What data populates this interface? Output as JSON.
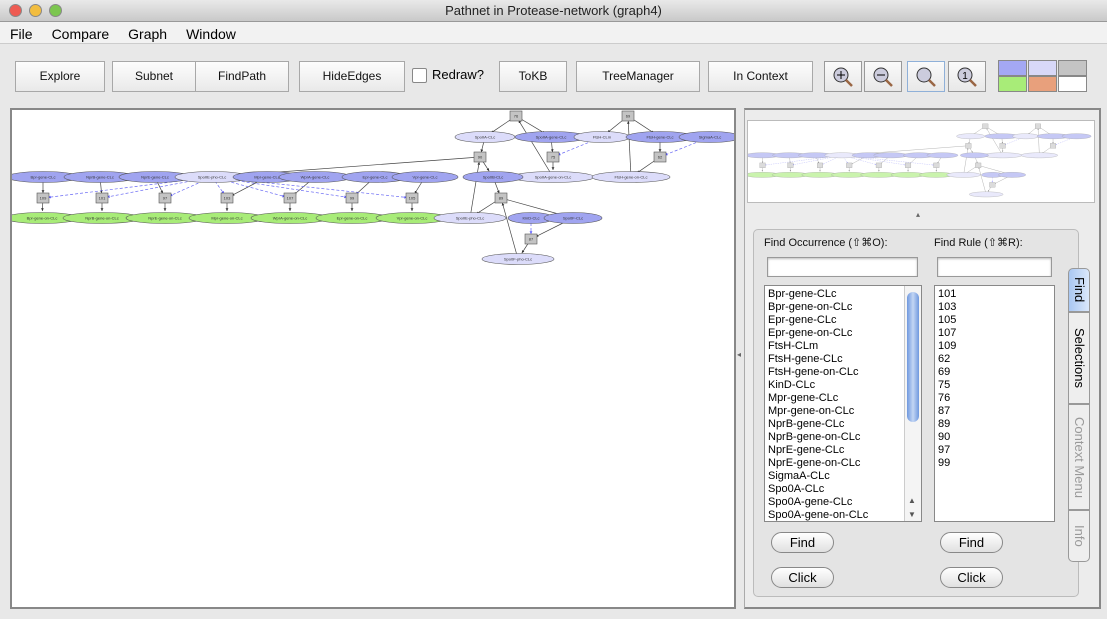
{
  "window": {
    "title": "Pathnet in Protease-network (graph4)"
  },
  "menu": [
    "File",
    "Compare",
    "Graph",
    "Window"
  ],
  "toolbar": {
    "explore": "Explore",
    "subnet": "Subnet",
    "findpath": "FindPath",
    "hideedges": "HideEdges",
    "redraw": "Redraw?",
    "redraw_checked": false,
    "tokb": "ToKB",
    "treemanager": "TreeManager",
    "incontext": "In Context"
  },
  "zoom_buttons": [
    "zoom-in-icon",
    "zoom-out-icon",
    "zoom-fit-icon",
    "zoom-actual-icon"
  ],
  "legend_colors": [
    "#a4a8f4",
    "#d8d8f8",
    "#c4c4c4",
    "#a8ec78",
    "#e8a07c",
    "#ffffff"
  ],
  "graph": {
    "colors": {
      "protein": "#a0a4f0",
      "complex": "#dcdcfa",
      "gene_on": "#a8ec78",
      "rule": "#c4c4c4"
    },
    "nodes": [
      {
        "id": "n1",
        "label": "Bpr-gene-CLc",
        "kind": "protein"
      },
      {
        "id": "n2",
        "label": "NprB-gene-CLc",
        "kind": "protein"
      },
      {
        "id": "n3",
        "label": "NprE-gene-CLc",
        "kind": "protein"
      },
      {
        "id": "n4",
        "label": "SpoIIE-pho-CLc",
        "kind": "complex"
      },
      {
        "id": "n5",
        "label": "Mpr-gene-CLc",
        "kind": "protein"
      },
      {
        "id": "n6",
        "label": "WprA-gene-CLc",
        "kind": "protein"
      },
      {
        "id": "n7",
        "label": "Epr-gene-CLc",
        "kind": "protein"
      },
      {
        "id": "n8",
        "label": "Vpr-gene-CLc",
        "kind": "protein"
      },
      {
        "id": "r1",
        "label": "109",
        "kind": "rule"
      },
      {
        "id": "r2",
        "label": "101",
        "kind": "rule"
      },
      {
        "id": "r3",
        "label": "97",
        "kind": "rule"
      },
      {
        "id": "r4",
        "label": "103",
        "kind": "rule"
      },
      {
        "id": "r5",
        "label": "107",
        "kind": "rule"
      },
      {
        "id": "r6",
        "label": "99",
        "kind": "rule"
      },
      {
        "id": "r7",
        "label": "105",
        "kind": "rule"
      },
      {
        "id": "g1",
        "label": "Bpr-gene-on-CLc",
        "kind": "gene_on"
      },
      {
        "id": "g2",
        "label": "NprB-gene-on-CLc",
        "kind": "gene_on"
      },
      {
        "id": "g3",
        "label": "NprE-gene-on-CLc",
        "kind": "gene_on"
      },
      {
        "id": "g4",
        "label": "Mpr-gene-on-CLc",
        "kind": "gene_on"
      },
      {
        "id": "g5",
        "label": "WprA-gene-on-CLc",
        "kind": "gene_on"
      },
      {
        "id": "g6",
        "label": "Epr-gene-on-CLc",
        "kind": "gene_on"
      },
      {
        "id": "g7",
        "label": "Vpr-gene-on-CLc",
        "kind": "gene_on"
      },
      {
        "id": "r76",
        "label": "76",
        "kind": "rule"
      },
      {
        "id": "r69",
        "label": "69",
        "kind": "rule"
      },
      {
        "id": "s1",
        "label": "SpoIIA-CLc",
        "kind": "complex"
      },
      {
        "id": "s2",
        "label": "SpoIIA-gene-CLc",
        "kind": "protein"
      },
      {
        "id": "f1",
        "label": "FtsH-CLm",
        "kind": "complex"
      },
      {
        "id": "f2",
        "label": "FtsH-gene-CLc",
        "kind": "protein"
      },
      {
        "id": "sa",
        "label": "SigmaA-CLc",
        "kind": "protein"
      },
      {
        "id": "r90",
        "label": "90",
        "kind": "rule"
      },
      {
        "id": "r75",
        "label": "75",
        "kind": "rule"
      },
      {
        "id": "r62",
        "label": "62",
        "kind": "rule"
      },
      {
        "id": "s3",
        "label": "SpoIIA-gene-on-CLc",
        "kind": "complex"
      },
      {
        "id": "f3",
        "label": "FtsH-gene-on-CLc",
        "kind": "complex"
      },
      {
        "id": "b0",
        "label": "Spo0B-CLc",
        "kind": "protein"
      },
      {
        "id": "r89",
        "label": "89",
        "kind": "rule"
      },
      {
        "id": "e1",
        "label": "SpoIIE-pho-CLc",
        "kind": "complex"
      },
      {
        "id": "k1",
        "label": "KinD-CLc",
        "kind": "protein"
      },
      {
        "id": "sf",
        "label": "Spo0F-CLc",
        "kind": "protein"
      },
      {
        "id": "r87",
        "label": "87",
        "kind": "rule"
      },
      {
        "id": "fp",
        "label": "Spo0F-pho-CLc",
        "kind": "complex"
      }
    ],
    "edges": [
      [
        "n1",
        "r1",
        "solid"
      ],
      [
        "n2",
        "r2",
        "solid"
      ],
      [
        "n3",
        "r3",
        "solid"
      ],
      [
        "n5",
        "r4",
        "solid"
      ],
      [
        "n6",
        "r5",
        "solid"
      ],
      [
        "n7",
        "r6",
        "solid"
      ],
      [
        "n8",
        "r7",
        "solid"
      ],
      [
        "r1",
        "g1",
        "solid"
      ],
      [
        "r2",
        "g2",
        "solid"
      ],
      [
        "r3",
        "g3",
        "solid"
      ],
      [
        "r4",
        "g4",
        "solid"
      ],
      [
        "r5",
        "g5",
        "solid"
      ],
      [
        "r6",
        "g6",
        "solid"
      ],
      [
        "r7",
        "g7",
        "solid"
      ],
      [
        "n4",
        "r1",
        "dashed"
      ],
      [
        "n4",
        "r2",
        "dashed"
      ],
      [
        "n4",
        "r3",
        "dashed"
      ],
      [
        "n4",
        "r4",
        "dashed"
      ],
      [
        "n4",
        "r5",
        "dashed"
      ],
      [
        "n4",
        "r6",
        "dashed"
      ],
      [
        "n4",
        "r7",
        "dashed"
      ],
      [
        "r76",
        "s1",
        "solid"
      ],
      [
        "r76",
        "s2",
        "solid"
      ],
      [
        "s1",
        "r90",
        "solid"
      ],
      [
        "s2",
        "r75",
        "solid"
      ],
      [
        "f1",
        "r75",
        "dashed"
      ],
      [
        "r75",
        "s3",
        "solid"
      ],
      [
        "s3",
        "r76",
        "solid"
      ],
      [
        "r69",
        "f1",
        "solid"
      ],
      [
        "r69",
        "f2",
        "solid"
      ],
      [
        "f2",
        "r62",
        "solid"
      ],
      [
        "sa",
        "r62",
        "dashed"
      ],
      [
        "r62",
        "f3",
        "solid"
      ],
      [
        "f3",
        "r69",
        "solid"
      ],
      [
        "r90",
        "n4",
        "solid"
      ],
      [
        "r90",
        "b0",
        "solid"
      ],
      [
        "b0",
        "r89",
        "solid"
      ],
      [
        "r89",
        "e1",
        "solid"
      ],
      [
        "r89",
        "sf",
        "solid"
      ],
      [
        "e1",
        "r90",
        "solid"
      ],
      [
        "k1",
        "r87",
        "dashed"
      ],
      [
        "sf",
        "r87",
        "solid"
      ],
      [
        "r87",
        "fp",
        "solid"
      ],
      [
        "fp",
        "r89",
        "solid"
      ]
    ]
  },
  "find": {
    "occurrence_label": "Find Occurrence (⇧⌘O):",
    "rule_label": "Find Rule (⇧⌘R):",
    "occurrence_value": "",
    "rule_value": "",
    "occurrences": [
      "Bpr-gene-CLc",
      "Bpr-gene-on-CLc",
      "Epr-gene-CLc",
      "Epr-gene-on-CLc",
      "FtsH-CLm",
      "FtsH-gene-CLc",
      "FtsH-gene-on-CLc",
      "KinD-CLc",
      "Mpr-gene-CLc",
      "Mpr-gene-on-CLc",
      "NprB-gene-CLc",
      "NprB-gene-on-CLc",
      "NprE-gene-CLc",
      "NprE-gene-on-CLc",
      "SigmaA-CLc",
      "Spo0A-CLc",
      "Spo0A-gene-CLc",
      "Spo0A-gene-on-CLc"
    ],
    "rules": [
      "101",
      "103",
      "105",
      "107",
      "109",
      "62",
      "69",
      "75",
      "76",
      "87",
      "89",
      "90",
      "97",
      "99"
    ],
    "find_button": "Find",
    "click_button": "Click"
  },
  "side_tabs": [
    "Find",
    "Selections",
    "Context Menu",
    "Info"
  ],
  "active_tab": "Find"
}
